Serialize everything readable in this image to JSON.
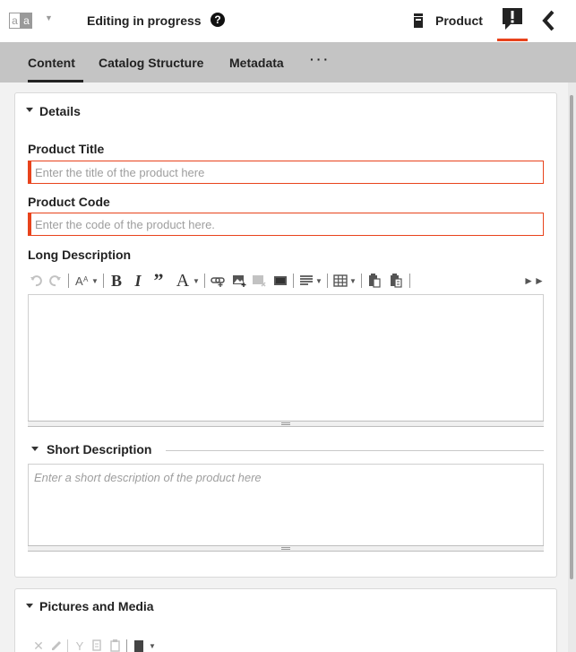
{
  "header": {
    "status": "Editing in progress",
    "doc_type": "Product",
    "accent": "#e8431c"
  },
  "tabs": [
    {
      "label": "Content",
      "active": true
    },
    {
      "label": "Catalog Structure",
      "active": false
    },
    {
      "label": "Metadata",
      "active": false
    }
  ],
  "more_tabs": "···",
  "details": {
    "title": "Details",
    "product_title": {
      "label": "Product Title",
      "placeholder": "Enter the title of the product here",
      "value": ""
    },
    "product_code": {
      "label": "Product Code",
      "placeholder": "Enter the code of the product here.",
      "value": ""
    },
    "long_description": {
      "label": "Long Description"
    },
    "short_description": {
      "label": "Short Description",
      "placeholder": "Enter a short description of the product here"
    }
  },
  "media": {
    "title": "Pictures and Media"
  },
  "icons": {
    "logo": "document-language-icon",
    "help": "question-circle-icon",
    "doc_type": "product-box-icon",
    "alert": "exclamation-speech-bubble-icon",
    "collapse": "chevron-left-icon"
  }
}
